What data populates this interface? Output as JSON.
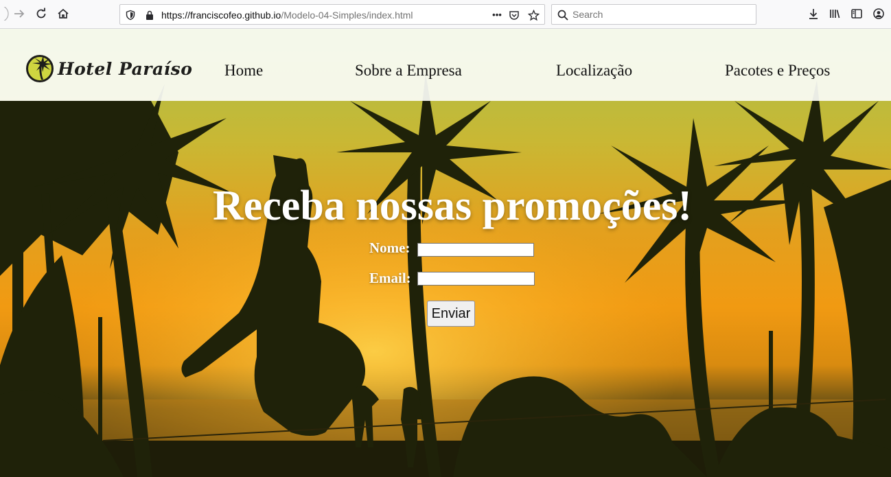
{
  "browser": {
    "url_host": "https://franciscofeo.github.io",
    "url_path": "/Modelo-04-Simples/index.html",
    "search_placeholder": "Search",
    "more_label": "•••"
  },
  "site": {
    "logo_text": "Hotel Paraíso",
    "nav": [
      "Home",
      "Sobre a Empresa",
      "Localização",
      "Pacotes e Preços"
    ]
  },
  "promo": {
    "heading": "Receba nossas promoções!",
    "name_label": "Nome:",
    "email_label": "Email:",
    "name_value": "",
    "email_value": "",
    "submit_label": "Enviar"
  },
  "colors": {
    "sky_top": "#b5c64a",
    "sky_mid": "#e8a71c",
    "sunset": "#f39e12",
    "silhouette": "#1e1d08",
    "header_bg": "#fafcf6"
  }
}
